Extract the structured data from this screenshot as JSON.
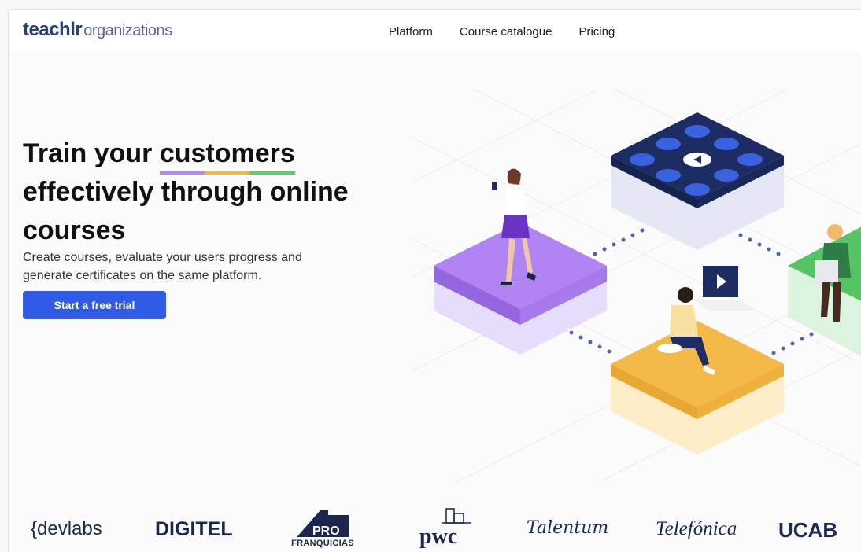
{
  "brand": {
    "logo_main": "teachlr",
    "logo_suffix": "organizations"
  },
  "nav": [
    "Platform",
    "Course catalogue",
    "Pricing"
  ],
  "hero": {
    "line1_pre": "Train your ",
    "line1_hl": "customers",
    "line2": "effectively through online",
    "line3": "courses",
    "subtitle": "Create courses, evaluate your users progress and generate certificates on the same platform.",
    "cta": "Start a free trial"
  },
  "underline_colors": [
    "#b388f0",
    "#f2b84b",
    "#5fcb6b"
  ],
  "client_logos": {
    "devlabs": "{devlabs",
    "digitel": "DIGITEL",
    "pro_franquicias": "FRANQUICIAS",
    "pro_mark": "PRO",
    "pwc": "pwc",
    "talentum": "Talentum",
    "telefonica": "Telefónica",
    "ucab": "UCAB"
  },
  "colors": {
    "accent": "#2f5be7",
    "logo": "#27407a"
  }
}
